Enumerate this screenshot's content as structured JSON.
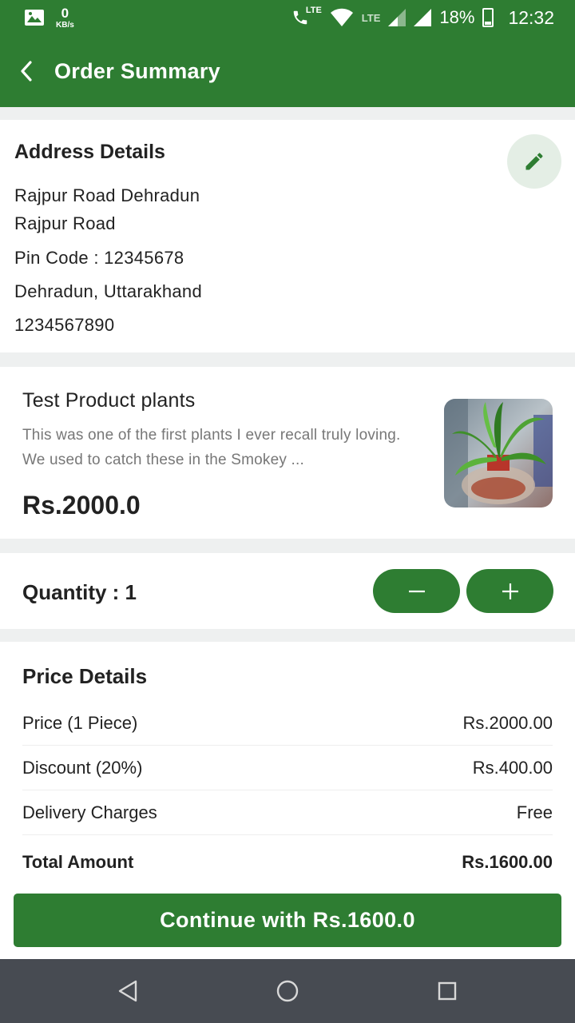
{
  "status_bar": {
    "net_speed_value": "0",
    "net_speed_unit": "KB/s",
    "lte_call": "LTE",
    "lte_signal": "LTE",
    "battery": "18%",
    "time": "12:32"
  },
  "app_bar": {
    "title": "Order Summary"
  },
  "address": {
    "title": "Address Details",
    "line1": "Rajpur Road Dehradun",
    "line2": "Rajpur Road",
    "pincode": "Pin Code : 12345678",
    "city_state": "Dehradun, Uttarakhand",
    "phone": "1234567890"
  },
  "product": {
    "name": "Test Product plants",
    "description": "This was one of the first plants I ever recall truly loving. We used to catch these in the Smokey ...",
    "price": "Rs.2000.0"
  },
  "quantity": {
    "label": "Quantity : 1",
    "minus": "−",
    "plus": "+"
  },
  "price_details": {
    "title": "Price Details",
    "rows": [
      {
        "label": "Price (1 Piece)",
        "value": "Rs.2000.00"
      },
      {
        "label": "Discount (20%)",
        "value": "Rs.400.00"
      },
      {
        "label": "Delivery Charges",
        "value": "Free"
      }
    ],
    "total_label": "Total Amount",
    "total_value": "Rs.1600.00"
  },
  "continue_button": "Continue with Rs.1600.0",
  "colors": {
    "primary": "#2e7d32",
    "nav_bar": "#474b52",
    "background": "#eef0f0"
  },
  "icons": {
    "back": "back-arrow-icon",
    "edit": "pencil-icon",
    "nav_back": "triangle-back-icon",
    "nav_home": "circle-home-icon",
    "nav_recent": "square-recents-icon"
  }
}
